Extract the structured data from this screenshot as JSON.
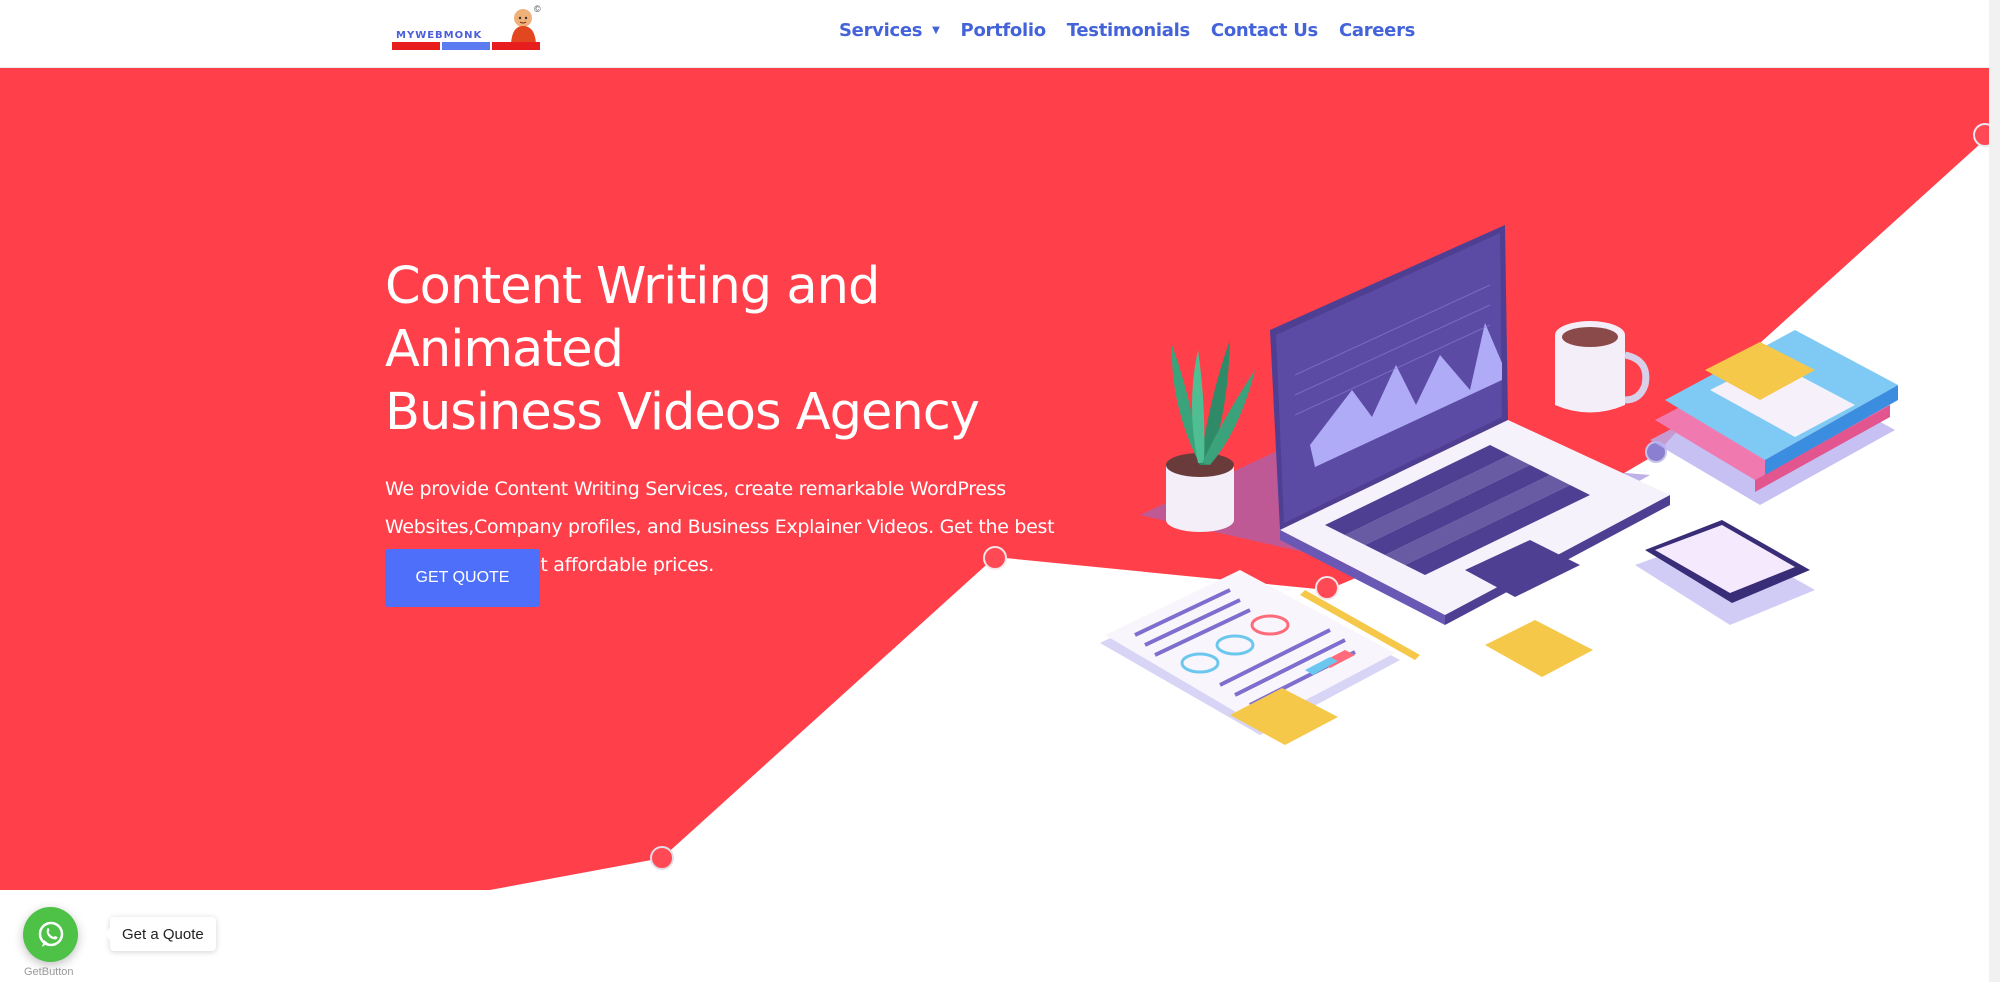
{
  "header": {
    "logo_text": "MYWEBMONK",
    "logo_mark": "©",
    "nav": [
      {
        "label": "Services",
        "has_dropdown": true
      },
      {
        "label": "Portfolio"
      },
      {
        "label": "Testimonials"
      },
      {
        "label": "Contact Us"
      },
      {
        "label": "Careers"
      }
    ]
  },
  "hero": {
    "title_line1": "Content Writing and Animated",
    "title_line2": "Business Videos Agency",
    "description": "We provide Content Writing Services, create remarkable WordPress Websites,Company profiles, and Business Explainer Videos. Get the best digital services at affordable prices.",
    "cta_label": "GET QUOTE"
  },
  "floating": {
    "label": "Get a Quote",
    "brand": "GetButton",
    "icon": "whatsapp-icon"
  },
  "colors": {
    "hero_red": "#ff3f4a",
    "nav_blue": "#4463d9",
    "cta_blue": "#4e6ffa",
    "whatsapp_green": "#4dc247"
  }
}
